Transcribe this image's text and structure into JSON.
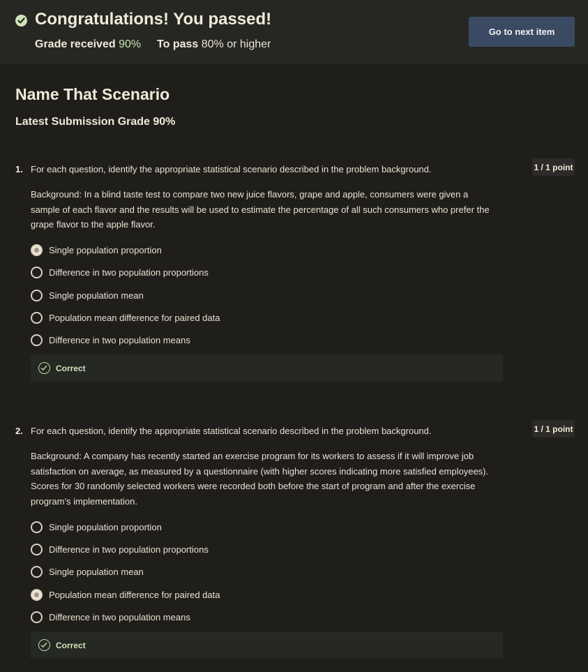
{
  "banner": {
    "title": "Congratulations! You passed!",
    "grade_received_label": "Grade received",
    "grade_received_value": "90%",
    "to_pass_label": "To pass",
    "to_pass_value": "80% or higher",
    "next_button_label": "Go to next item"
  },
  "quiz": {
    "title": "Name That Scenario",
    "latest_grade": "Latest Submission Grade 90%"
  },
  "questions": [
    {
      "number": "1.",
      "prompt": "For each question, identify the appropriate statistical scenario described in the problem background.",
      "points": "1 / 1 point",
      "background": [
        "Background: In a blind taste test to compare two new juice flavors, grape and apple, consumers were given a",
        "sample of each flavor and the results will be used to estimate the percentage of all such consumers who prefer the",
        "grape flavor to the apple flavor."
      ],
      "options": [
        {
          "label": "Single population proportion",
          "selected": true
        },
        {
          "label": "Difference in two population proportions",
          "selected": false
        },
        {
          "label": "Single population mean",
          "selected": false
        },
        {
          "label": "Population mean difference for paired data",
          "selected": false
        },
        {
          "label": "Difference in two population means",
          "selected": false
        }
      ],
      "feedback": "Correct"
    },
    {
      "number": "2.",
      "prompt": "For each question, identify the appropriate statistical scenario described in the problem background.",
      "points": "1 / 1 point",
      "background": [
        "Background: A company has recently started an exercise program for its workers to assess if it will improve job",
        "satisfaction on average, as measured by a questionnaire (with higher scores indicating more satisfied employees).",
        "Scores for 30 randomly selected workers were recorded both before the start of program and after the exercise",
        "program’s implementation."
      ],
      "options": [
        {
          "label": "Single population proportion",
          "selected": false
        },
        {
          "label": "Difference in two population proportions",
          "selected": false
        },
        {
          "label": "Single population mean",
          "selected": false
        },
        {
          "label": "Population mean difference for paired data",
          "selected": true
        },
        {
          "label": "Difference in two population means",
          "selected": false
        }
      ],
      "feedback": "Correct"
    }
  ],
  "colors": {
    "background": "#1f1e1b",
    "banner": "#262723",
    "button": "#3b4a63",
    "success": "#cfe3b6"
  }
}
